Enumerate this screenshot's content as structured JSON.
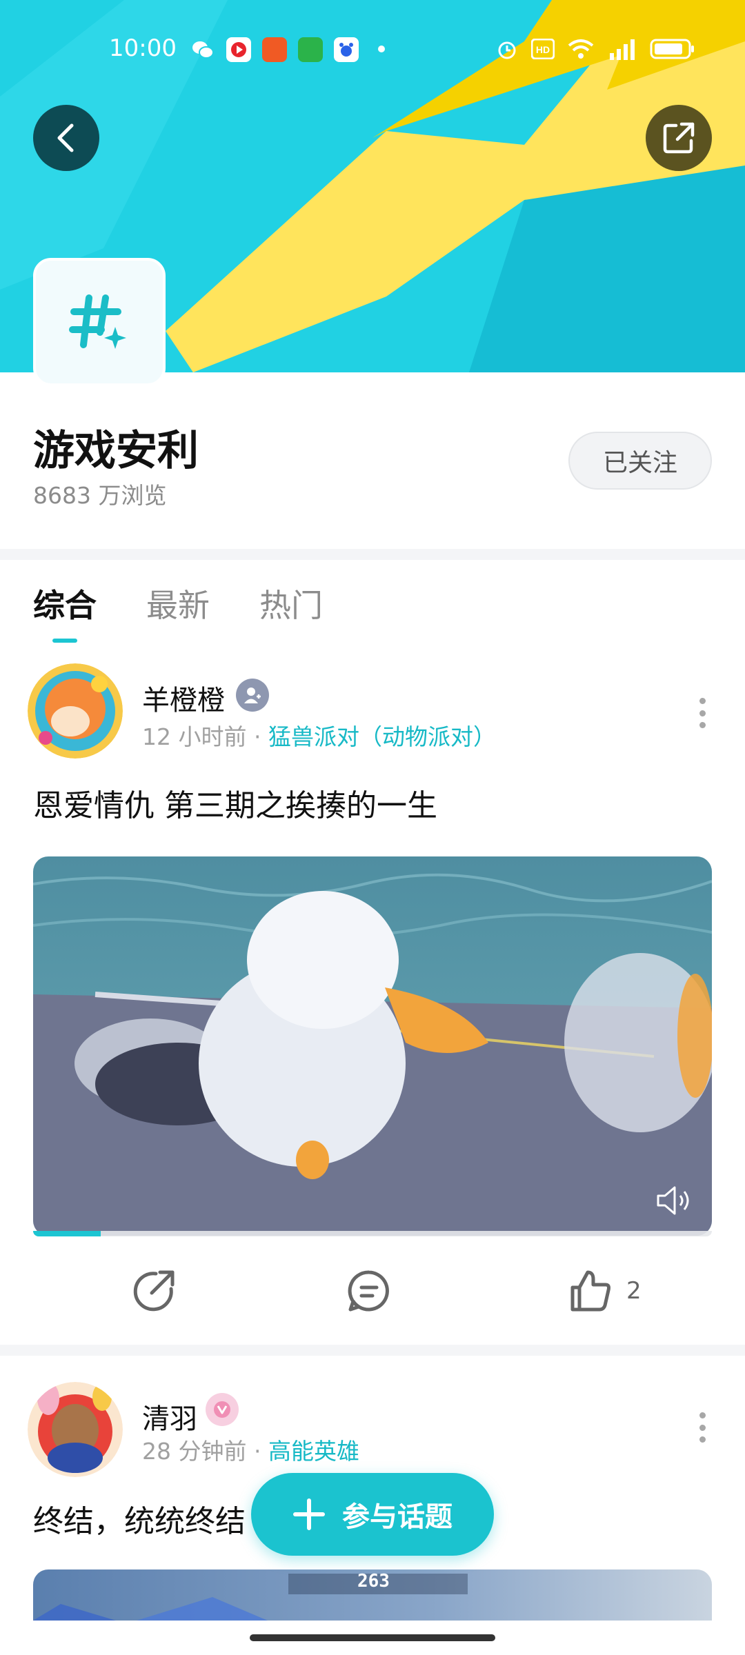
{
  "status_bar": {
    "time": "10:00"
  },
  "colors": {
    "accent": "#1cc5d2",
    "banner_cyan": "#1fc9de",
    "banner_yellow": "#ffe45c"
  },
  "topic": {
    "title": "游戏安利",
    "views": "8683 万浏览",
    "follow_label": "已关注",
    "icon": "hashtag-sparkle-icon"
  },
  "tabs": [
    {
      "label": "综合",
      "active": true
    },
    {
      "label": "最新",
      "active": false
    },
    {
      "label": "热门",
      "active": false
    }
  ],
  "posts": [
    {
      "author": "羊橙橙",
      "time": "12 小时前",
      "separator": "·",
      "game": "猛兽派对（动物派对）",
      "title": "恩爱情仇 第三期之挨揍的一生",
      "video_progress": 0.1,
      "like_count": "2"
    },
    {
      "author": "清羽",
      "time": "28 分钟前",
      "separator": "·",
      "game": "高能英雄",
      "title": "终结，统统终结",
      "media_text": "263"
    }
  ],
  "fab": {
    "label": "参与话题"
  }
}
